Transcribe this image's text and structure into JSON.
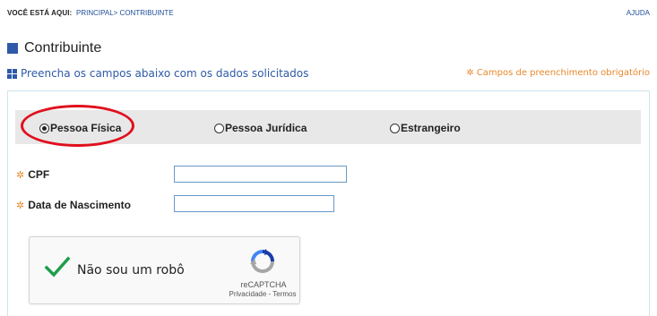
{
  "topbar": {
    "location_label": "VOCÊ ESTÁ AQUI:",
    "breadcrumb_home": "PRINCIPAL",
    "breadcrumb_separator": ">",
    "breadcrumb_current": "CONTRIBUINTE",
    "help": "AJUDA"
  },
  "page": {
    "title": "Contribuinte",
    "subtitle": "Preencha os campos abaixo com os dados solicitados",
    "required_note": "Campos de preenchimento obrigatório",
    "required_symbol": "✲"
  },
  "person_type": {
    "selected": "Pessoa Física",
    "options": [
      {
        "label": "Pessoa Física",
        "checked": true
      },
      {
        "label": "Pessoa Jurídica",
        "checked": false
      },
      {
        "label": "Estrangeiro",
        "checked": false
      }
    ]
  },
  "form": {
    "cpf": {
      "label": "CPF",
      "value": "",
      "placeholder": ""
    },
    "birth_date": {
      "label": "Data de Nascimento",
      "value": "",
      "placeholder": ""
    }
  },
  "captcha": {
    "text": "Não sou um robô",
    "brand": "reCAPTCHA",
    "privacy": "Privacidade",
    "separator": " - ",
    "terms": "Termos",
    "checked": true
  },
  "colors": {
    "accent_blue": "#2e5aa8",
    "required_orange": "#e8882a",
    "annotation_red": "#e0101d",
    "check_green": "#1e9e4a"
  }
}
